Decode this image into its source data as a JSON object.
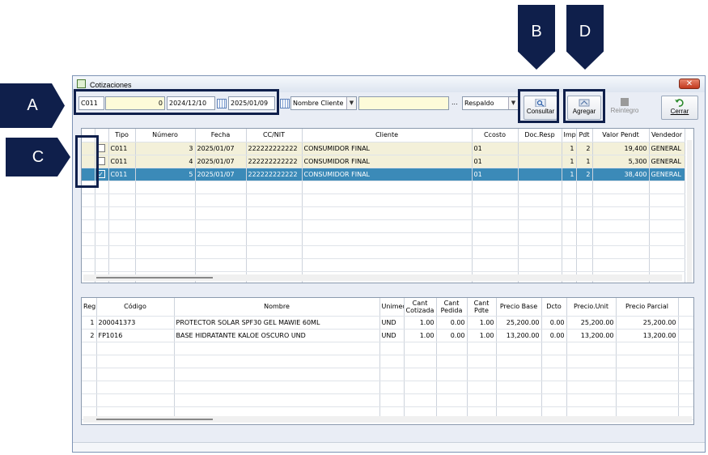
{
  "callouts": {
    "a": "A",
    "b": "B",
    "c": "C",
    "d": "D"
  },
  "window": {
    "title": "Cotizaciones",
    "close_glyph": "✕"
  },
  "filters": {
    "tipo": "C011",
    "numero": "0",
    "fecha_desde": "2024/12/10",
    "fecha_hasta": "2025/01/09",
    "campo_busqueda": "Nombre Cliente",
    "busqueda_valor": "",
    "ellipsis": "...",
    "estado": "Respaldo"
  },
  "toolbar": {
    "consultar": "Consultar",
    "agregar": "Agregar",
    "reintegro": "Reintegro",
    "cerrar": "Cerrar"
  },
  "quotes": {
    "headers": [
      "",
      "Tipo",
      "Número",
      "Fecha",
      "CC/NIT",
      "Cliente",
      "Ccosto",
      "Doc.Resp",
      "Impr",
      "Pdt",
      "Valor Pendt",
      "Vendedor"
    ],
    "rows": [
      {
        "checked": false,
        "tipo": "C011",
        "numero": "3",
        "fecha": "2025/01/07",
        "nit": "222222222222",
        "cliente": "CONSUMIDOR FINAL",
        "ccosto": "01",
        "docresp": "",
        "impr": "1",
        "pdt": "2",
        "valor": "19,400",
        "vendedor": "GENERAL"
      },
      {
        "checked": false,
        "tipo": "C011",
        "numero": "4",
        "fecha": "2025/01/07",
        "nit": "222222222222",
        "cliente": "CONSUMIDOR FINAL",
        "ccosto": "01",
        "docresp": "",
        "impr": "1",
        "pdt": "1",
        "valor": "5,300",
        "vendedor": "GENERAL"
      },
      {
        "checked": true,
        "tipo": "C011",
        "numero": "5",
        "fecha": "2025/01/07",
        "nit": "222222222222",
        "cliente": "CONSUMIDOR FINAL",
        "ccosto": "01",
        "docresp": "",
        "impr": "1",
        "pdt": "2",
        "valor": "38,400",
        "vendedor": "GENERAL"
      }
    ]
  },
  "details": {
    "headers": {
      "reg": "Reg",
      "codigo": "Código",
      "nombre": "Nombre",
      "unimed": "Unimed",
      "cant_cotizada_1": "Cant",
      "cant_cotizada_2": "Cotizada",
      "cant_pedida_1": "Cant",
      "cant_pedida_2": "Pedida",
      "cant_pdte_1": "Cant",
      "cant_pdte_2": "Pdte",
      "precio_base": "Precio Base",
      "dcto": "Dcto",
      "precio_unit": "Precio.Unit",
      "precio_parcial": "Precio Parcial"
    },
    "rows": [
      {
        "reg": "1",
        "codigo": "200041373",
        "nombre": "PROTECTOR SOLAR SPF30 GEL MAWIE 60ML",
        "unimed": "UND",
        "cotizada": "1.00",
        "pedida": "0.00",
        "pdte": "1.00",
        "base": "25,200.00",
        "dcto": "0.00",
        "unit": "25,200.00",
        "parcial": "25,200.00"
      },
      {
        "reg": "2",
        "codigo": "FP1016",
        "nombre": "BASE HIDRATANTE KALOE OSCURO UND",
        "unimed": "UND",
        "cotizada": "1.00",
        "pedida": "0.00",
        "pdte": "1.00",
        "base": "13,200.00",
        "dcto": "0.00",
        "unit": "13,200.00",
        "parcial": "13,200.00"
      }
    ]
  },
  "colors": {
    "callout": "#0f1f4b",
    "selected_row": "#3b8ab8",
    "beige_row": "#f3f0d9",
    "input_yellow": "#fdfbd9"
  }
}
